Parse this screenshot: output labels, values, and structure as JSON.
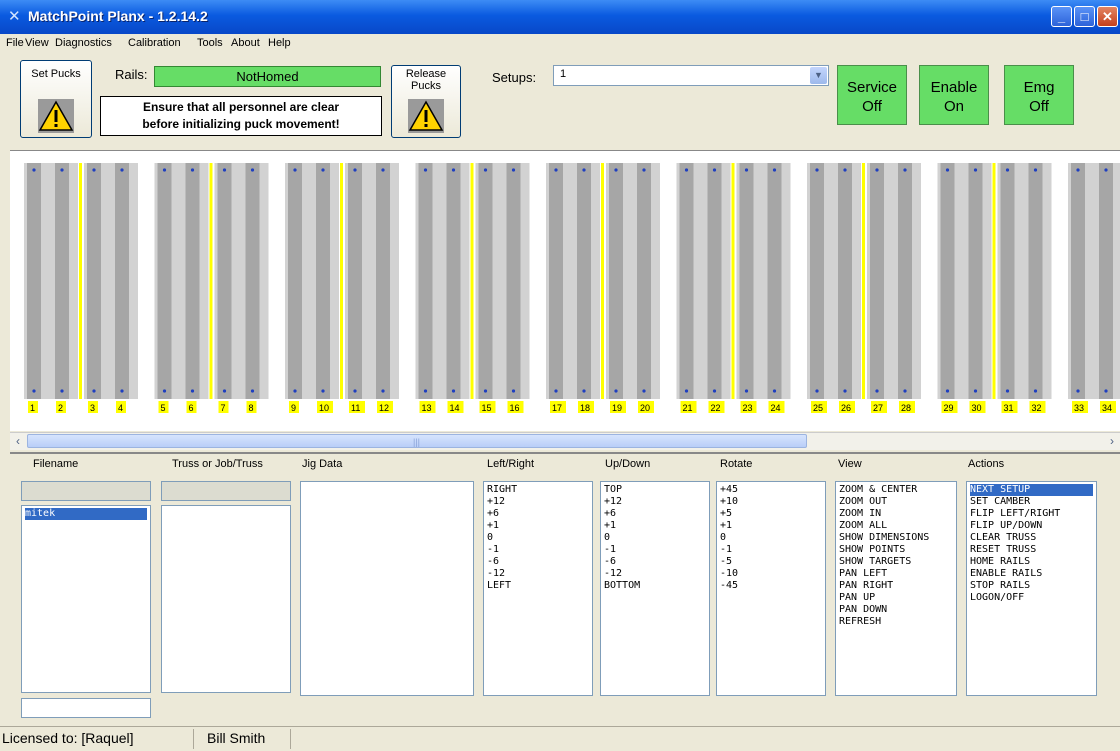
{
  "window": {
    "title": "MatchPoint Planx - 1.2.14.2"
  },
  "menu": [
    "File",
    "View",
    "Diagnostics",
    "Calibration",
    "Tools",
    "About",
    "Help"
  ],
  "toolbar": {
    "set_pucks_label": "Set Pucks",
    "rails_label": "Rails:",
    "rails_status": "NotHomed",
    "warning_line1": "Ensure that all personnel are clear",
    "warning_line2": "before initializing puck movement!",
    "release_pucks_line1": "Release",
    "release_pucks_line2": "Pucks",
    "setups_label": "Setups:",
    "setups_value": "1",
    "service_line1": "Service",
    "service_line2": "Off",
    "enable_line1": "Enable",
    "enable_line2": "On",
    "emg_line1": "Emg",
    "emg_line2": "Off"
  },
  "rails": {
    "numbers": [
      "1",
      "2",
      "3",
      "4",
      "5",
      "6",
      "7",
      "8",
      "9",
      "10",
      "11",
      "12",
      "13",
      "14",
      "15",
      "16",
      "17",
      "18",
      "19",
      "20",
      "21",
      "22",
      "23",
      "24",
      "25",
      "26",
      "27",
      "28",
      "29",
      "30",
      "31",
      "32",
      "33",
      "34"
    ]
  },
  "colors": {
    "rail_dark": "#a6a6a6",
    "rail_light": "#d2d2d2",
    "divider": "#ffff00",
    "puck": "#1f3fbf",
    "status_green": "#66dd66"
  },
  "panel": {
    "headers": {
      "filename": "Filename",
      "truss": "Truss or Job/Truss",
      "jig": "Jig Data",
      "leftright": "Left/Right",
      "updown": "Up/Down",
      "rotate": "Rotate",
      "view": "View",
      "actions": "Actions"
    },
    "filename_items": [
      "mitek"
    ],
    "leftright_items": [
      "RIGHT",
      "+12",
      "+6",
      "+1",
      "0",
      "-1",
      "-6",
      "-12",
      "LEFT"
    ],
    "updown_items": [
      "TOP",
      "+12",
      "+6",
      "+1",
      "0",
      "-1",
      "-6",
      "-12",
      "BOTTOM"
    ],
    "rotate_items": [
      "+45",
      "+10",
      "+5",
      "+1",
      "0",
      "-1",
      "-5",
      "-10",
      "-45"
    ],
    "view_items": [
      "ZOOM & CENTER",
      "ZOOM OUT",
      "ZOOM IN",
      "ZOOM ALL",
      "SHOW DIMENSIONS",
      "SHOW POINTS",
      "SHOW TARGETS",
      "PAN LEFT",
      "PAN RIGHT",
      "PAN UP",
      "PAN DOWN",
      "REFRESH"
    ],
    "actions_items": [
      "NEXT SETUP",
      "SET CAMBER",
      "FLIP LEFT/RIGHT",
      "FLIP UP/DOWN",
      "CLEAR TRUSS",
      "RESET TRUSS",
      "HOME RAILS",
      "ENABLE RAILS",
      "STOP RAILS",
      "LOGON/OFF"
    ]
  },
  "status": {
    "licensed": "Licensed to:  [Raquel]",
    "user": "Bill Smith"
  }
}
